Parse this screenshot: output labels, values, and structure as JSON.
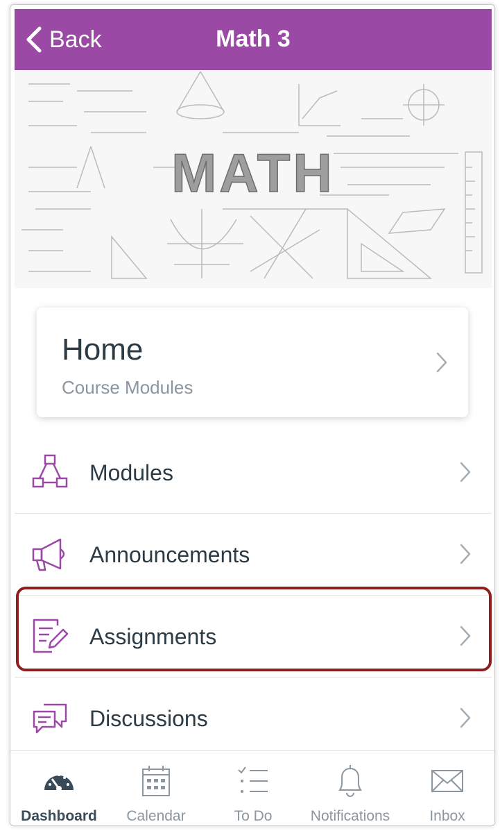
{
  "colors": {
    "accent": "#9a49a5",
    "text": "#2d3b45",
    "muted": "#8b969e",
    "highlight": "#8f1f1f"
  },
  "nav": {
    "back_label": "Back",
    "title": "Math 3",
    "back_icon": "chevron-left-icon"
  },
  "banner": {
    "word": "MATH"
  },
  "home": {
    "title": "Home",
    "subtitle": "Course Modules",
    "chevron_icon": "chevron-right-icon"
  },
  "menu": [
    {
      "label": "Modules",
      "icon": "modules-icon"
    },
    {
      "label": "Announcements",
      "icon": "megaphone-icon"
    },
    {
      "label": "Assignments",
      "icon": "assignment-icon",
      "highlighted": true
    },
    {
      "label": "Discussions",
      "icon": "discussion-icon"
    }
  ],
  "tabs": [
    {
      "label": "Dashboard",
      "icon": "dashboard-icon",
      "active": true
    },
    {
      "label": "Calendar",
      "icon": "calendar-icon"
    },
    {
      "label": "To Do",
      "icon": "todo-icon"
    },
    {
      "label": "Notifications",
      "icon": "bell-icon"
    },
    {
      "label": "Inbox",
      "icon": "envelope-icon"
    }
  ]
}
